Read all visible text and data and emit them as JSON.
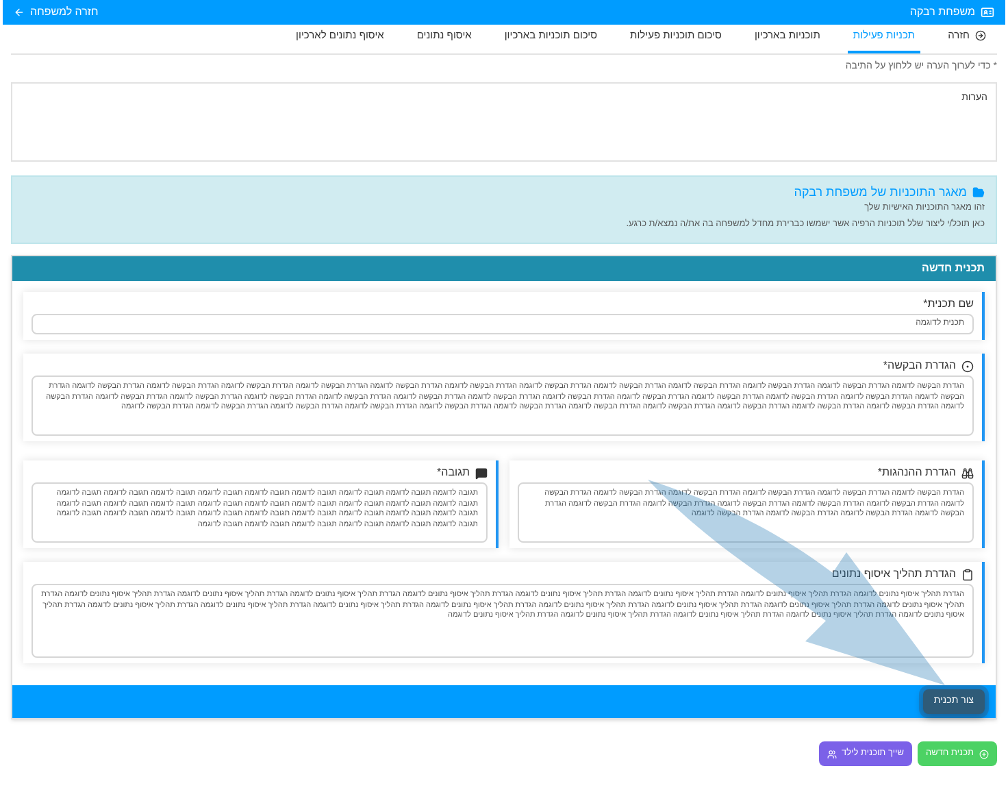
{
  "header": {
    "title": "משפחת רבקה",
    "back_link": "חזרה למשפחה"
  },
  "tabs": [
    {
      "label": "חזרה",
      "kind": "back",
      "selected": false
    },
    {
      "label": "תכניות פעילות",
      "kind": "tab",
      "selected": true
    },
    {
      "label": "תוכניות בארכיון",
      "kind": "tab",
      "selected": false
    },
    {
      "label": "סיכום תוכניות פעילות",
      "kind": "tab",
      "selected": false
    },
    {
      "label": "סיכום תוכניות בארכיון",
      "kind": "tab",
      "selected": false
    },
    {
      "label": "איסוף נתונים",
      "kind": "tab",
      "selected": false
    },
    {
      "label": "איסוף נתונים לארכיון",
      "kind": "tab",
      "selected": false
    }
  ],
  "edit_hint": "* כדי לערוך הערה יש ללחוץ על התיבה",
  "comments": {
    "label": "הערות"
  },
  "info": {
    "title": "מאגר התוכניות של משפחת רבקה",
    "lines": [
      "זהו מאגר התוכניות האישיות שלך",
      "כאן תוכל/י ליצור שלל תוכניות הרפיה אשר ישמשו כברירת מחדל למשפחה בה את/ה נמצא/ת כרגע."
    ]
  },
  "card": {
    "title": "תכנית חדשה",
    "name_field": {
      "label": "שם תכנית*",
      "value": "תכנית לדוגמה"
    },
    "request": {
      "label": "הגדרת הבקשה*",
      "value": "הגדרת הבקשה לדוגמה הגדרת הבקשה לדוגמה הגדרת הבקשה לדוגמה הגדרת הבקשה לדוגמה הגדרת הבקשה לדוגמה הגדרת הבקשה לדוגמה הגדרת הבקשה לדוגמה הגדרת הבקשה לדוגמה הגדרת הבקשה לדוגמה הגדרת הבקשה לדוגמה הגדרת הבקשה לדוגמה הגדרת הבקשה לדוגמה הגדרת הבקשה לדוגמה הגדרת הבקשה לדוגמה הגדרת הבקשה לדוגמה הגדרת הבקשה לדוגמה הגדרת הבקשה לדוגמה הגדרת הבקשה לדוגמה הגדרת הבקשה לדוגמה הגדרת הבקשה לדוגמה הגדרת הבקשה לדוגמה הגדרת הבקשה לדוגמה הגדרת הבקשה לדוגמה הגדרת הבקשה לדוגמה הגדרת הבקשה לדוגמה הגדרת הבקשה לדוגמה הגדרת הבקשה לדוגמה הגדרת הבקשה לדוגמה הגדרת הבקשה לדוגמה הגדרת הבקשה לדוגמה הגדרת הבקשה לדוגמה הגדרת הבקשה לדוגמה הגדרת הבקשה לדוגמה הגדרת הבקשה לדוגמה הגדרת הבקשה לדוגמה הגדרת הבקשה לדוגמה"
    },
    "behaviors": {
      "label": "הגדרת ההנהגות*",
      "value": "הגדרת הבקשה לדוגמה הגדרת הבקשה לדוגמה הגדרת הבקשה לדוגמה הגדרת הבקשה לדוגמה הגדרת הבקשה לדוגמה הגדרת הבקשה לדוגמה הגדרת הבקשה לדוגמה הגדרת הבקשה לדוגמה הגדרת הבקשה לדוגמה הגדרת הבקשה לדוגמה הגדרת הבקשה לדוגמה הגדרת הבקשה לדוגמה הגדרת הבקשה לדוגמה הגדרת הבקשה לדוגמה הגדרת הבקשה לדוגמה"
    },
    "response": {
      "label": "תגובה*",
      "value": "תגובה לדוגמה תגובה לדוגמה תגובה לדוגמה תגובה לדוגמה תגובה לדוגמה תגובה לדוגמה תגובה לדוגמה תגובה לדוגמה תגובה לדוגמה תגובה לדוגמה תגובה לדוגמה תגובה לדוגמה תגובה לדוגמה תגובה לדוגמה תגובה לדוגמה תגובה לדוגמה תגובה לדוגמה תגובה לדוגמה תגובה לדוגמה תגובה לדוגמה תגובה לדוגמה תגובה לדוגמה תגובה לדוגמה תגובה לדוגמה תגובה לדוגמה תגובה לדוגמה תגובה לדוגמה תגובה לדוגמה תגובה לדוגמה תגובה לדוגמה תגובה לדוגמה תגובה לדוגמה תגובה לדוגמה"
    },
    "data_process": {
      "label": "הגדרת תהליך איסוף נתונים",
      "value": "הגדרת תהליך איסוף נתונים לדוגמה הגדרת תהליך איסוף נתונים לדוגמה הגדרת תהליך איסוף נתונים לדוגמה הגדרת תהליך איסוף נתונים לדוגמה הגדרת תהליך איסוף נתונים לדוגמה הגדרת תהליך איסוף נתונים לדוגמה הגדרת תהליך איסוף נתונים לדוגמה הגדרת תהליך איסוף נתונים לדוגמה הגדרת תהליך איסוף נתונים לדוגמה הגדרת תהליך איסוף נתונים לדוגמה הגדרת תהליך איסוף נתונים לדוגמה הגדרת תהליך איסוף נתונים לדוגמה הגדרת תהליך איסוף נתונים לדוגמה הגדרת תהליך איסוף נתונים לדוגמה הגדרת תהליך איסוף נתונים לדוגמה הגדרת תהליך איסוף נתונים לדוגמה הגדרת תהליך איסוף נתונים לדוגמה הגדרת תהליך איסוף נתונים לדוגמה הגדרת תהליך איסוף נתונים לדוגמה הגדרת תהליך איסוף נתונים לדוגמה הגדרת תהליך איסוף נתונים לדוגמה"
    },
    "submit": "צור תכנית"
  },
  "actions": [
    {
      "label": "תכנית חדשה",
      "kind": "new"
    },
    {
      "label": "שייך תוכנית לילד",
      "kind": "assign"
    }
  ]
}
